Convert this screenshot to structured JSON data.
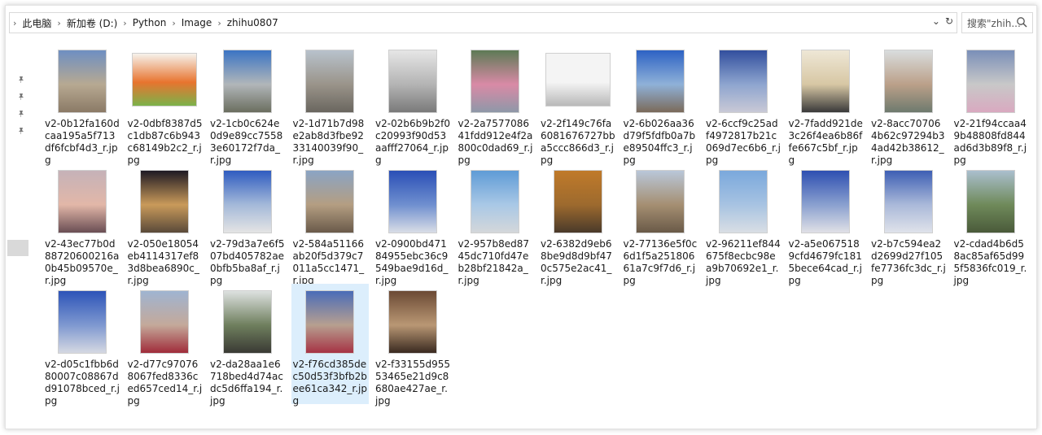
{
  "breadcrumbs": [
    "此电脑",
    "新加卷 (D:)",
    "Python",
    "Image",
    "zhihu0807"
  ],
  "search": {
    "placeholder": "搜索\"zhih..."
  },
  "files": [
    {
      "name": "v2-0b12fa160dcaa195a5f713df6fcbf4d3_r.jpg",
      "colors": [
        "#6e8fc2",
        "#b7a992",
        "#8b7a66"
      ],
      "wide": false
    },
    {
      "name": "v2-0dbf8387d5c1db87c6b943c68149b2c2_r.jpg",
      "colors": [
        "#f6f2ec",
        "#e8742f",
        "#7bb24a"
      ],
      "wide": true
    },
    {
      "name": "v2-1cb0c624e0d9e89cc75583e60172f7da_r.jpg",
      "colors": [
        "#3b74c4",
        "#b1b6b9",
        "#6b6e5f"
      ],
      "wide": false
    },
    {
      "name": "v2-1d71b7d98e2ab8d3fbe9233140039f90_r.jpg",
      "colors": [
        "#b8c2cc",
        "#9a948a",
        "#6a665f"
      ],
      "wide": false
    },
    {
      "name": "v2-02b6b9b2f0c20993f90d53aafff27064_r.jpg",
      "colors": [
        "#e6e6e6",
        "#b4b4b4",
        "#7a7a7a"
      ],
      "wide": false
    },
    {
      "name": "v2-2a757708641fdd912e4f2a800c0dad69_r.jpg",
      "colors": [
        "#5d7a55",
        "#d98aa6",
        "#8e98a8"
      ],
      "wide": false
    },
    {
      "name": "v2-2f149c76fa6081676727bba5ccc866d3_r.jpg",
      "colors": [
        "#f4f4f4",
        "#f4f4f4",
        "#b9b9b9"
      ],
      "wide": true
    },
    {
      "name": "v2-6b026aa36d79f5fdfb0a7be89504ffc3_r.jpg",
      "colors": [
        "#2d62c4",
        "#8fb1d8",
        "#7b6a5a"
      ],
      "wide": false
    },
    {
      "name": "v2-6ccf9c25adf4972817b21c069d7ec6b6_r.jpg",
      "colors": [
        "#324f9e",
        "#8ea5cf",
        "#c9c9d6"
      ],
      "wide": false
    },
    {
      "name": "v2-7fadd921de3c26f4ea6b86ffe667c5bf_r.jpg",
      "colors": [
        "#eee7d6",
        "#d7c7a4",
        "#3a3a3a"
      ],
      "wide": false
    },
    {
      "name": "v2-8acc707064b62c97294b34ad42b38612_r.jpg",
      "colors": [
        "#d9ddde",
        "#bba089",
        "#6e7a6e"
      ],
      "wide": false
    },
    {
      "name": "v2-21f94ccaa49b48808fd844ad6d3b89f8_r.jpg",
      "colors": [
        "#7a8fb8",
        "#c8c8c8",
        "#d9a9c0"
      ],
      "wide": false
    },
    {
      "name": "v2-43ec77b0d88720600216a0b45b09570e_r.jpg",
      "colors": [
        "#c5b2b8",
        "#e2b7a8",
        "#6a4e54"
      ],
      "wide": false
    },
    {
      "name": "v2-050e18054eb4114317ef83d8bea6890c_r.jpg",
      "colors": [
        "#1e1a23",
        "#c99a5a",
        "#5a4a3a"
      ],
      "wide": false
    },
    {
      "name": "v2-79d3a7e6f507bd405782ae0bfb5ba8af_r.jpg",
      "colors": [
        "#2f5cc0",
        "#a4b9d9",
        "#e4e4e4"
      ],
      "wide": false
    },
    {
      "name": "v2-584a51166ab20f5d379c7011a5cc1471_r.jpg",
      "colors": [
        "#8aa4c4",
        "#b49e82",
        "#6a5a4a"
      ],
      "wide": false
    },
    {
      "name": "v2-0900bd47184955ebc36c9549bae9d16d_r.jpg",
      "colors": [
        "#2a4fb6",
        "#6f8fcf",
        "#d9dde6"
      ],
      "wide": false
    },
    {
      "name": "v2-957b8ed8745dc710fd47eb28bf21842a_r.jpg",
      "colors": [
        "#5f9bd6",
        "#a9c8e6",
        "#d4d7da"
      ],
      "wide": false
    },
    {
      "name": "v2-6382d9eb68be9d8d9bf470c575e2ac41_r.jpg",
      "colors": [
        "#c07a2a",
        "#9d6a2e",
        "#4a3a2a"
      ],
      "wide": false
    },
    {
      "name": "v2-77136e5f0c6d1f5a25180661a7c9f7d6_r.jpg",
      "colors": [
        "#b9c7d9",
        "#a58f72",
        "#6a5a48"
      ],
      "wide": false
    },
    {
      "name": "v2-96211ef844675f8ecbc98ea9b70692e1_r.jpg",
      "colors": [
        "#7aa8dc",
        "#a7c3e2",
        "#d9dee4"
      ],
      "wide": false
    },
    {
      "name": "v2-a5e0675189cfd4679fc1815bece64cad_r.jpg",
      "colors": [
        "#2e4fb1",
        "#8aa0cf",
        "#e0e0e6"
      ],
      "wide": false
    },
    {
      "name": "v2-b7c594ea2d2699d27f105fe7736fc3dc_r.jpg",
      "colors": [
        "#3e5fb4",
        "#aab9d9",
        "#dfe2ea"
      ],
      "wide": false
    },
    {
      "name": "v2-cdad4b6d58ac85af65d995f5836fc019_r.jpg",
      "colors": [
        "#aabfce",
        "#6f8a5a",
        "#4a5a3a"
      ],
      "wide": false
    },
    {
      "name": "v2-d05c1fbb6d80007c08867dd91078bced_r.jpg",
      "colors": [
        "#2d54b8",
        "#7e98d0",
        "#d5d8e2"
      ],
      "wide": false
    },
    {
      "name": "v2-d77c970768067fed8336ced657ced14_r.jpg",
      "colors": [
        "#9fb4d1",
        "#c4a99a",
        "#a02c3a"
      ],
      "wide": false
    },
    {
      "name": "v2-da28aa1e6718bed4d74acdc5d6ffa194_r.jpg",
      "colors": [
        "#dde1e0",
        "#6f7f5e",
        "#3a3a34"
      ],
      "wide": false
    },
    {
      "name": "v2-f76cd385dec50d53f3bfb2bee61ca342_r.jpg",
      "colors": [
        "#4a6cb8",
        "#b79f90",
        "#a63344"
      ],
      "wide": false,
      "selected": true
    },
    {
      "name": "v2-f33155d95553465e21d9c8680ae427ae_r.jpg",
      "colors": [
        "#6b4a34",
        "#b99774",
        "#3a2a20"
      ],
      "wide": false
    }
  ]
}
